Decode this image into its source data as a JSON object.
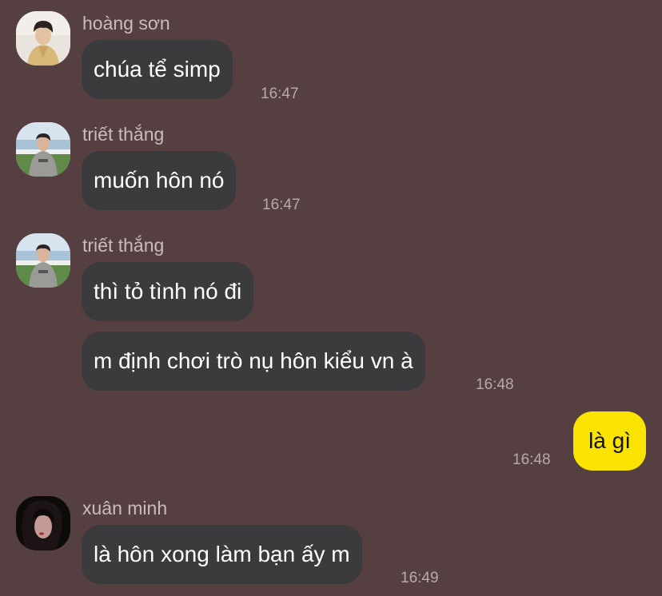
{
  "colors": {
    "background": "#553f40",
    "incoming_bubble": "#3b3a3c",
    "outgoing_bubble": "#fbe300"
  },
  "messages": [
    {
      "sender": "hoàng sơn",
      "avatar": "avatar-hoang-son",
      "text": "chúa tể simp",
      "time": "16:47"
    },
    {
      "sender": "triết thắng",
      "avatar": "avatar-triet-thang",
      "text": "muốn hôn nó",
      "time": "16:47"
    },
    {
      "sender": "triết thắng",
      "avatar": "avatar-triet-thang",
      "texts": [
        "thì tỏ tình nó đi",
        "m định chơi trò nụ hôn kiểu vn à"
      ],
      "time": "16:48"
    },
    {
      "outgoing": true,
      "text": "là gì",
      "time": "16:48"
    },
    {
      "sender": "xuân minh",
      "avatar": "avatar-xuan-minh",
      "text": "là hôn xong làm bạn ấy m",
      "time": "16:49"
    }
  ]
}
